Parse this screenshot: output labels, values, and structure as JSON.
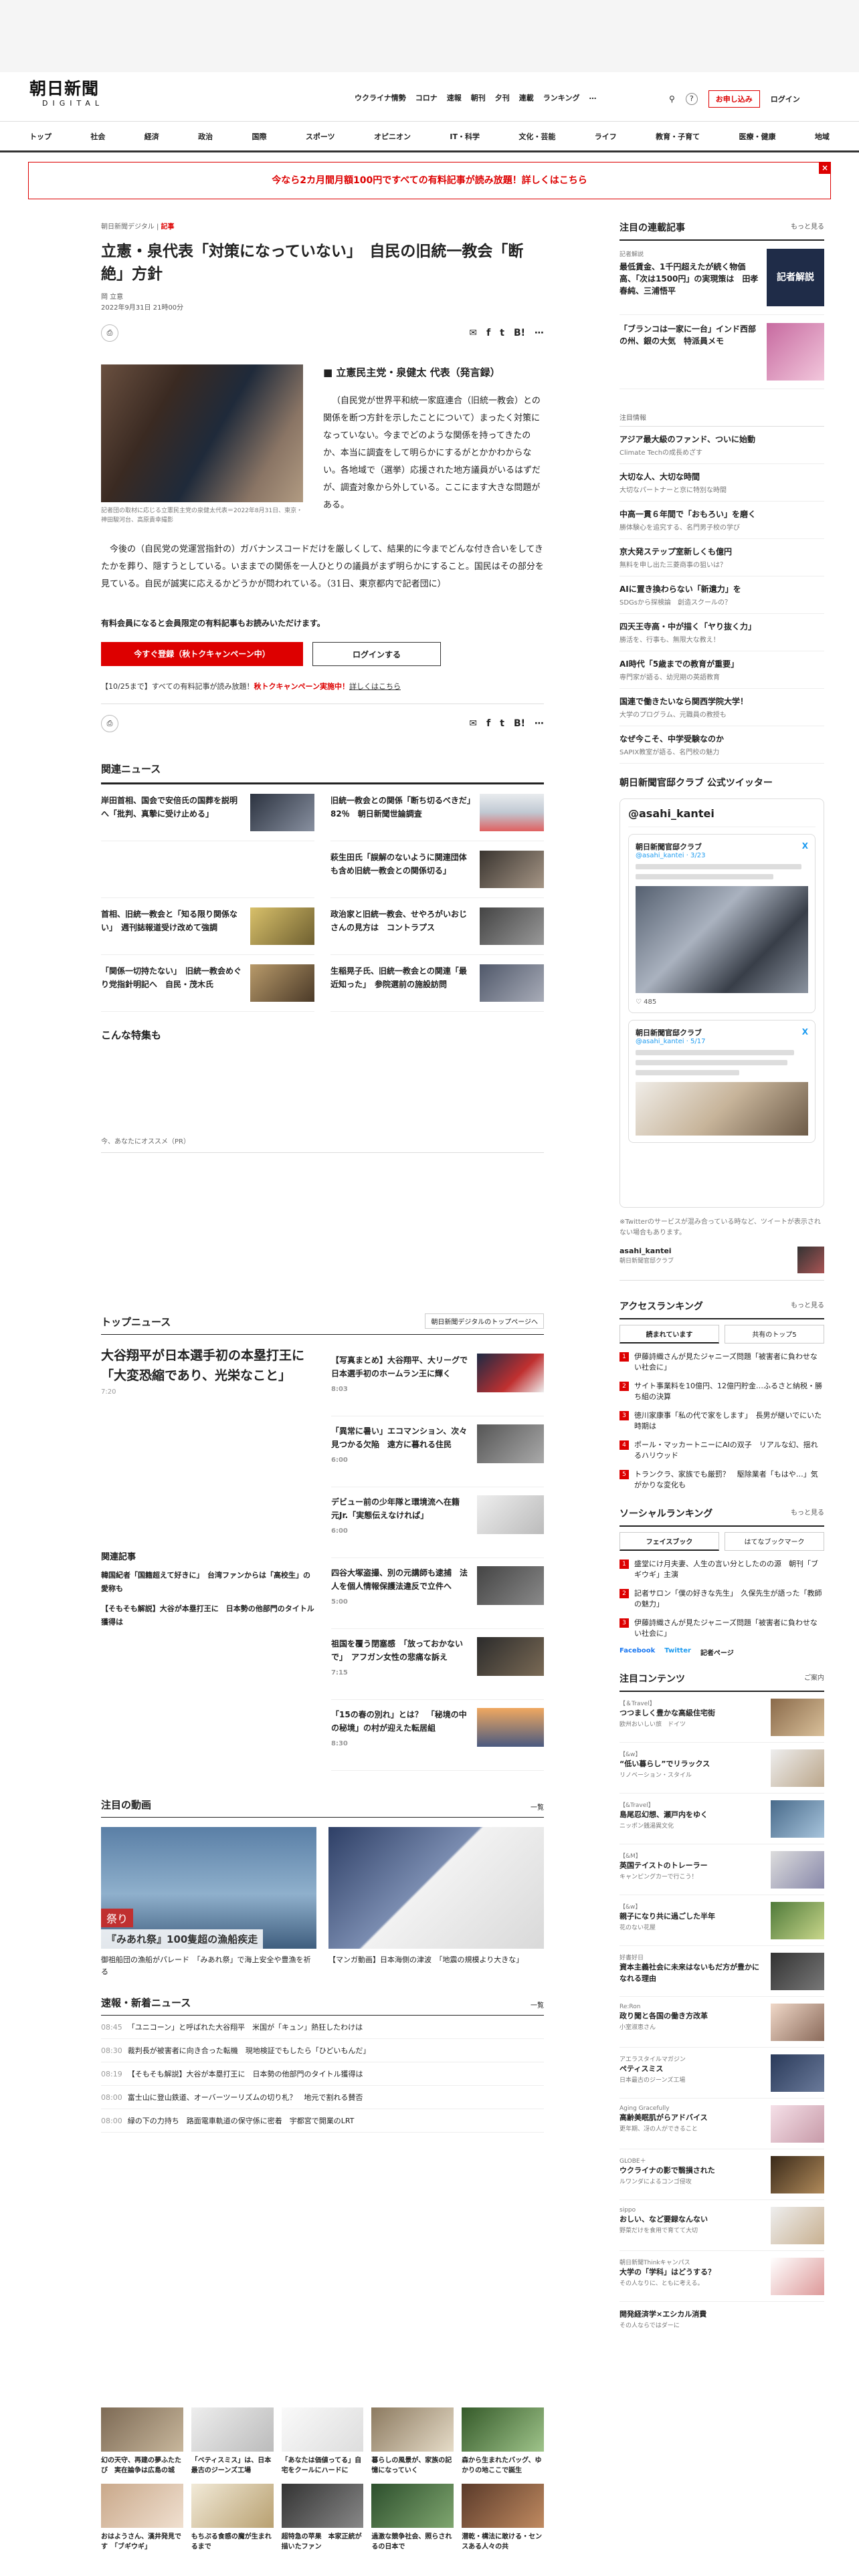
{
  "header": {
    "logo_jp": "朝日新聞",
    "logo_en": "DIGITAL",
    "nav": [
      "ウクライナ情勢",
      "コロナ",
      "速報",
      "朝刊",
      "夕刊",
      "連載",
      "ランキング",
      "…"
    ],
    "cta": "お申し込み",
    "login": "ログイン"
  },
  "categories": [
    "トップ",
    "社会",
    "経済",
    "政治",
    "国際",
    "スポーツ",
    "オピニオン",
    "IT・科学",
    "文化・芸能",
    "ライフ",
    "教育・子育て",
    "医療・健康",
    "地域"
  ],
  "banner": "今なら2カ月間月額100円ですべての有料記事が読み放題！詳しくはこちら",
  "article": {
    "breadcrumb_site": "朝日新聞デジタル",
    "breadcrumb_type": "記事",
    "title": "立憲・泉代表「対策になっていない」　自民の旧統一教会「断絶」方針",
    "author": "岡 立意",
    "date": "2022年9月31日 21時00分",
    "share_count": "list",
    "share_count2": "0",
    "photo_caption": "記者団の取材に応じる立憲民主党の泉健太代表＝2022年8月31日、東京・神田駿河台、高原貴幸撮影",
    "lead_heading": "■ 立憲民主党・泉健太 代表（発言録）",
    "lead_text": "（自民党が世界平和統一家庭連合（旧統一教会）との関係を断つ方針を示したことについて）まったく対策になっていない。今までどのような関係を持ってきたのか、本当に調査をして明らかにするがとかかわからない。各地域で（選挙）応援された地方議員がいるはずだが、調査対象から外している。ここにます大きな問題がある。",
    "body_text": "今後の（自民党の党運営指針の）ガバナンスコードだけを厳しくして、結果的に今までどんな付き合いをしてきたかを葬り、隠すうとしている。いままでの関係を一人ひとりの議員がまず明らかにすること。国民はその部分を見ている。自民が誠実に応えるかどうかが問われている。（31日、東京都内で記者団に）",
    "members_note": "有料会員になると会員限定の有料記事もお読みいただけます。",
    "register_btn": "今すぐ登録（秋トクキャンペーン中）",
    "login_btn": "ログインする",
    "campaign_text": "【10/25まで】すべての有料記事が読み放題！",
    "campaign_link": "秋トクキャンペーン実施中！",
    "campaign_tail": "詳しくはこちら"
  },
  "related": {
    "title": "関連ニュース",
    "items": [
      "岸田首相、国会で安倍氏の国葬を説明へ「批判、真摯に受け止める」",
      "旧統一教会との関係「断ち切るべきだ」82％　朝日新聞世論調査",
      "",
      "萩生田氏「誤解のないように関連団体も含め旧統一教会との関係切る」",
      "首相、旧統一教会と「知る限り関係ない」　週刊誌報道受け改めて強調",
      "政治家と旧統一教会、せやろがいおじさんの見方は　コントラプス",
      "「関係一切持たない」　旧統一教会めぐり党指針明記へ　自民・茂木氏",
      "生稲晃子氏、旧統一教会との関連「最近知った」　参院選前の施設訪問"
    ]
  },
  "features": {
    "title": "こんな特集も",
    "pr": "今、あなたにオススメ（PR）"
  },
  "topnews": {
    "title": "トップニュース",
    "link": "朝日新聞デジタルのトップページへ",
    "main_title": "大谷翔平が日本選手初の本塁打王に「大変恐縮であり、光栄なこと」",
    "main_time": "7:20",
    "related_h": "関連記事",
    "related": [
      "韓国紀者「国籍超えて好きに」　台湾ファンからは「高校生」の愛称も",
      "【そもそも解説】大谷が本塁打王に　日本勢の他部門のタイトル獲得は"
    ],
    "items": [
      {
        "t": "【写真まとめ】大谷翔平、大リーグで日本選手初のホームラン王に輝く",
        "tm": "8:03"
      },
      {
        "t": "「異常に暑い」エコマンション、次々見つかる欠陥　遠方に暮れる住民",
        "tm": "6:00"
      },
      {
        "t": "デビュー前の少年隊と環境流へ在籍　元Jr.「実態伝えなければ」",
        "tm": "6:00"
      },
      {
        "t": "四谷大塚盗撮、別の元講師も逮捕　法人を個人情報保護法違反で立件へ",
        "tm": "5:00"
      },
      {
        "t": "祖国を覆う閉塞感　「放っておかないで」　アフガン女性の悲痛な訴え",
        "tm": "7:15"
      },
      {
        "t": "「15の春の別れ」とは？　「秘境の中の秘境」の村が迎えた転居組",
        "tm": "8:30"
      }
    ]
  },
  "videos": {
    "title": "注目の動画",
    "more": "一覧",
    "overlay_a": "祭り",
    "overlay_b": "『みあれ祭』100隻超の漁船疾走",
    "items": [
      "御祖船団の漁船がパレード　「みあれ祭」で海上安全や豊漁を祈る",
      "【マンガ動画】日本海側の津波　「地震の規模より大きな」"
    ]
  },
  "flash": {
    "title": "速報・新着ニュース",
    "more": "一覧",
    "items": [
      {
        "tm": "08:45",
        "t": "「ユニコーン」と呼ばれた大谷翔平　米国が「キュン」熱狂したわけは"
      },
      {
        "tm": "08:30",
        "t": "裁判長が被害者に向き合った転機　現地検証でもしたら「ひどいもんだ」"
      },
      {
        "tm": "08:19",
        "t": "【そもそも解説】大谷が本塁打王に　日本勢の他部門のタイトル獲得は"
      },
      {
        "tm": "08:00",
        "t": "富士山に登山鉄道、オーバーツーリズムの切り札？　地元で割れる賛否"
      },
      {
        "tm": "08:00",
        "t": "緑の下の力持ち　路面電車軌道の保守係に密着　宇都宮で開業のLRT"
      }
    ]
  },
  "bottom_grid": [
    "幻の天守、再建の夢ふたたび　実在論争は広島の城",
    "「ベティスミス」は、日本最古のジーンズ工場",
    "「あなたは価値ってる」自宅をクールにハードに",
    "暮らしの風景が、家族の記憶になっていく",
    "森から生まれたバッグ、ゆかりの地ここで誕生"
  ],
  "bottom_grid2": [
    "おはようさん、漢井発見です　「ブギウギ」",
    "もちぷる食感の魔が生まれるまで",
    "超特急の苹果　本家正統が描いたファン",
    "過激な競争社会、照らされるの日本で",
    "潜乾・構法に敢ける・センスある人々の共"
  ],
  "sidebar": {
    "serial_title": "注目の連載記事",
    "more": "もっと見る",
    "serial": [
      {
        "k": "記者解説",
        "t": "最低賃金、1千円超えたが続く物価高、「次は1500円」の実現策は　田孝春純、三浦悟平"
      },
      {
        "k": "",
        "t": "「ブランコは一家に一台」インド西部の州、銀の大気　特派員メモ"
      }
    ],
    "ad_label": "注目情報",
    "ads": [
      {
        "t": "アジア最大級のファンド、ついに始動",
        "s": "Climate Techの成長めざす"
      },
      {
        "t": "大切な人、大切な時間",
        "s": "大切なパートナーと京に特別な時間"
      },
      {
        "t": "中高一貫６年間で「おもろい」を磨く",
        "s": "勝体験心を追究する、名門男子校の学び"
      },
      {
        "t": "京大発ステップ室新しくも億円",
        "s": "無料を申し出た三菱商事の狙いは？"
      },
      {
        "t": "AIに置き換わらない「新遺力」を",
        "s": "SDGsから探検論　創造スクールの？"
      },
      {
        "t": "四天王寺高・中が描く「ヤり抜く力」",
        "s": "勝活を、行事も、無限大な教え！"
      },
      {
        "t": "AI時代「5歳までの教育が重要」",
        "s": "専門家が語る、幼児期の英語教育"
      },
      {
        "t": "国連で働きたいなら関西学院大学！",
        "s": "大学のプログラム、元職員の教授も"
      },
      {
        "t": "なぜ今こそ、中学受験なのか",
        "s": "SAPIX教室が語る、名門校の魅力"
      }
    ],
    "twitter_title": "朝日新聞官邸クラブ 公式ツイッター",
    "twitter_handle": "@asahi_kantei",
    "tw_name": "朝日新聞官邸クラブ",
    "tw_id": "@asahi_kantei · 3/23",
    "tw_id2": "@asahi_kantei · 5/17",
    "tw_likes": "485",
    "tw_note": "※Twitterのサービスが混み合っている時など、ツイートが表示されない場合もあります。",
    "acc_name": "asahi_kantei",
    "acc_sub": "朝日新聞官邸クラブ",
    "rank_title": "アクセスランキング",
    "rank_tabs": [
      "読まれています",
      "共有のトップ5"
    ],
    "rank": [
      "伊藤詩織さんが見たジャニーズ問題「被害者に負わせない社会に」",
      "サイト事業料を10億円、12億円貯金…ふるさと納税・勝ち組の決算",
      "徳川家康事「私の代で家をします」　長男が継いでにいた時期は",
      "ポール・マッカートニーにAIの双子　リアルな幻、揺れるハリウッド",
      "トランクラ、家族でも厳罰？　駆除業者「もはや…」気がかりな変化も"
    ],
    "social_title": "ソーシャルランキング",
    "social_tabs": [
      "フェイスブック",
      "はてなブックマーク"
    ],
    "social": [
      "盛堂にけ月夫妻、人生の言い分としたのの源　朝刊「ブギウギ」主演",
      "記者サロン「僕の好きな先生」　久保先生が語った「教師の魅力」",
      "伊藤詩織さんが見たジャニーズ問題「被害者に負わせない社会に」"
    ],
    "social_links": [
      "Facebook",
      "Twitter",
      "記者ページ"
    ],
    "cc_title": "注目コンテンツ",
    "cc_more": "ご案内",
    "cc": [
      {
        "k": "【＆Travel】",
        "t": "つつましく豊かな高級住宅街",
        "s": "欧州おいしい旅　ドイツ"
      },
      {
        "k": "【&w】",
        "t": "“低い暮らし”でリラックス",
        "s": "リノベーション・スタイル"
      },
      {
        "k": "【&Travel】",
        "t": "島尾忍幻想、瀬戸内をゆく",
        "s": "ニッポン銭湯異文化"
      },
      {
        "k": "【&M】",
        "t": "英国テイストのトレーラー",
        "s": "キャンピングカーで行こう！"
      },
      {
        "k": "【&w】",
        "t": "親子になり共に過ごした半年",
        "s": "花のない花屋"
      },
      {
        "k": "好書好日",
        "t": "資本主義社会に未来はないもだ方が豊かになれる理由",
        "s": ""
      },
      {
        "k": "Re:Ron",
        "t": "政り聞と各国の働き方改革",
        "s": "小室淑恵さん"
      },
      {
        "k": "アエラスタイルマガジン",
        "t": "ペティスミス",
        "s": "日本最古のジーンズ工場"
      },
      {
        "k": "Aging Gracefully",
        "t": "高齢美眠肌がらアドバイス",
        "s": "更年期、冴の人ができること"
      },
      {
        "k": "GLOBE＋",
        "t": "ウクライナの影で翳損された",
        "s": "ルワンダによるコンゴ侵攻"
      },
      {
        "k": "sippo",
        "t": "おしい、など要録なんない",
        "s": "野菜だけを食用で育てて大切"
      },
      {
        "k": "朝日新聞Thinkキャンパス",
        "t": "大学の「学科」はどうする？",
        "s": "その人なりに、ともに考える。"
      },
      {
        "k": "",
        "t": "開発経済学×エシカル消費",
        "s": "その人ならではダーに"
      }
    ]
  }
}
